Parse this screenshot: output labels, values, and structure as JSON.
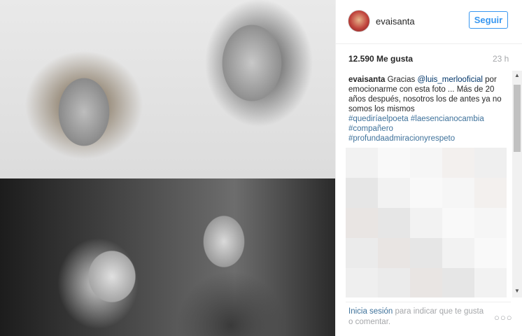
{
  "post": {
    "username": "evaisanta",
    "follow_label": "Seguir",
    "likes": "12.590 Me gusta",
    "time": "23 h",
    "caption": {
      "user": "evaisanta",
      "text_1": "Gracias",
      "mention": "@luis_merlooficial",
      "text_2": "por emocionarme con esta foto ... Más de 20 años después, nosotros los de antes ya no somos los mismos",
      "hashtags": [
        "#quediríaelpoeta",
        "#laesencianocambia",
        "#compañero",
        "#profundaadmiracionyrespeto"
      ]
    }
  },
  "footer": {
    "login_link": "Inicia sesión",
    "login_text": "para indicar que te gusta o comentar.",
    "more_icon": "ellipsis-icon"
  },
  "scrollbar": {
    "up_icon": "▲",
    "down_icon": "▼"
  }
}
